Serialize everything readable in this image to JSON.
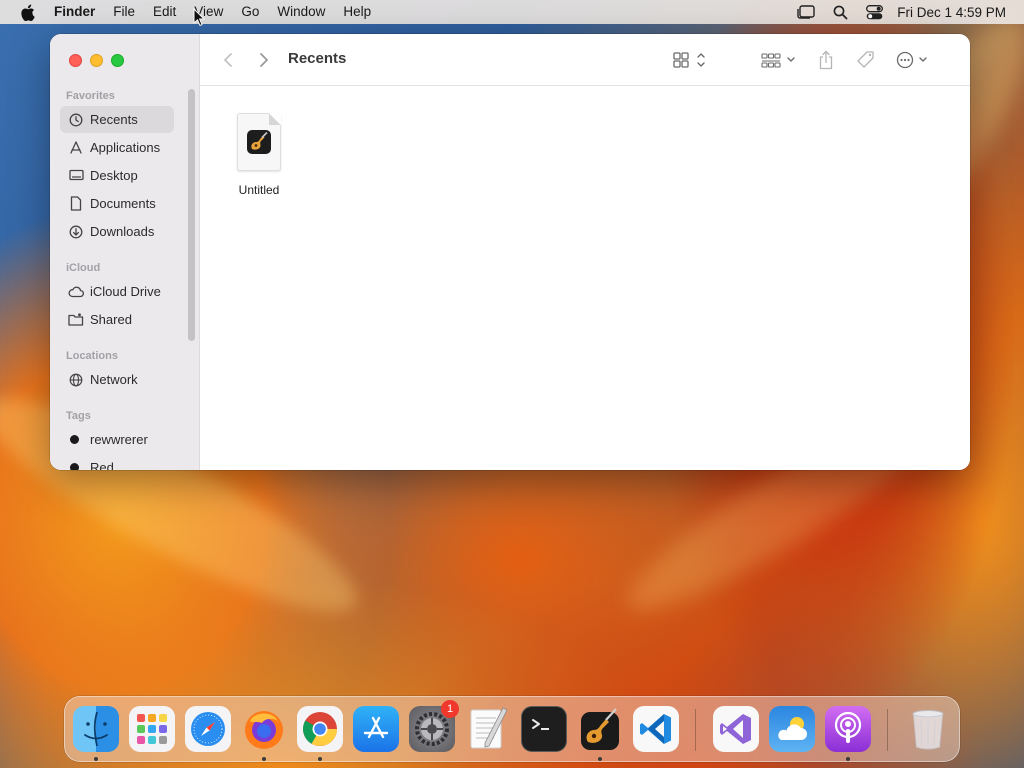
{
  "menubar": {
    "app_name": "Finder",
    "items": [
      "File",
      "Edit",
      "View",
      "Go",
      "Window",
      "Help"
    ],
    "clock": "Fri Dec 1  4:59 PM"
  },
  "window": {
    "title": "Recents",
    "sidebar": {
      "sections": {
        "favorites": "Favorites",
        "icloud": "iCloud",
        "locations": "Locations",
        "tags": "Tags"
      },
      "favorites": [
        {
          "label": "Recents",
          "icon": "clock-icon",
          "active": true
        },
        {
          "label": "Applications",
          "icon": "applications-icon"
        },
        {
          "label": "Desktop",
          "icon": "desktop-icon"
        },
        {
          "label": "Documents",
          "icon": "document-icon"
        },
        {
          "label": "Downloads",
          "icon": "download-icon"
        }
      ],
      "icloud": [
        {
          "label": "iCloud Drive",
          "icon": "cloud-icon"
        },
        {
          "label": "Shared",
          "icon": "shared-folder-icon"
        }
      ],
      "locations": [
        {
          "label": "Network",
          "icon": "globe-icon"
        }
      ],
      "tags": [
        {
          "label": "rewwrerer",
          "color": "#1a1a1a"
        },
        {
          "label": "Red",
          "color": "#1a1a1a"
        }
      ]
    },
    "files": [
      {
        "name": "Untitled",
        "icon": "garageband-document-icon"
      }
    ]
  },
  "dock": {
    "apps": [
      {
        "name": "Finder",
        "icon": "finder-icon",
        "running": true
      },
      {
        "name": "Launchpad",
        "icon": "launchpad-icon"
      },
      {
        "name": "Safari",
        "icon": "safari-icon"
      },
      {
        "name": "Firefox",
        "icon": "firefox-icon",
        "running": true
      },
      {
        "name": "Chrome",
        "icon": "chrome-icon",
        "running": true
      },
      {
        "name": "App Store",
        "icon": "app-store-icon"
      },
      {
        "name": "System Settings",
        "icon": "settings-icon",
        "badge": "1"
      },
      {
        "name": "TextEdit",
        "icon": "textedit-icon"
      },
      {
        "name": "Terminal",
        "icon": "terminal-icon"
      },
      {
        "name": "GarageBand",
        "icon": "garageband-icon",
        "running": true
      },
      {
        "name": "Visual Studio Code",
        "icon": "vscode-icon"
      },
      {
        "name": "Visual Studio",
        "icon": "visual-studio-icon"
      },
      {
        "name": "Weather",
        "icon": "weather-icon"
      },
      {
        "name": "Podcasts",
        "icon": "podcasts-icon",
        "running": true
      },
      {
        "name": "Trash",
        "icon": "trash-icon"
      }
    ]
  },
  "colors": {
    "close": "#fe5f57",
    "minimize": "#febc2e",
    "zoom": "#28c840",
    "sidebar_bg": "#ece9ed",
    "badge": "#f0382c"
  }
}
